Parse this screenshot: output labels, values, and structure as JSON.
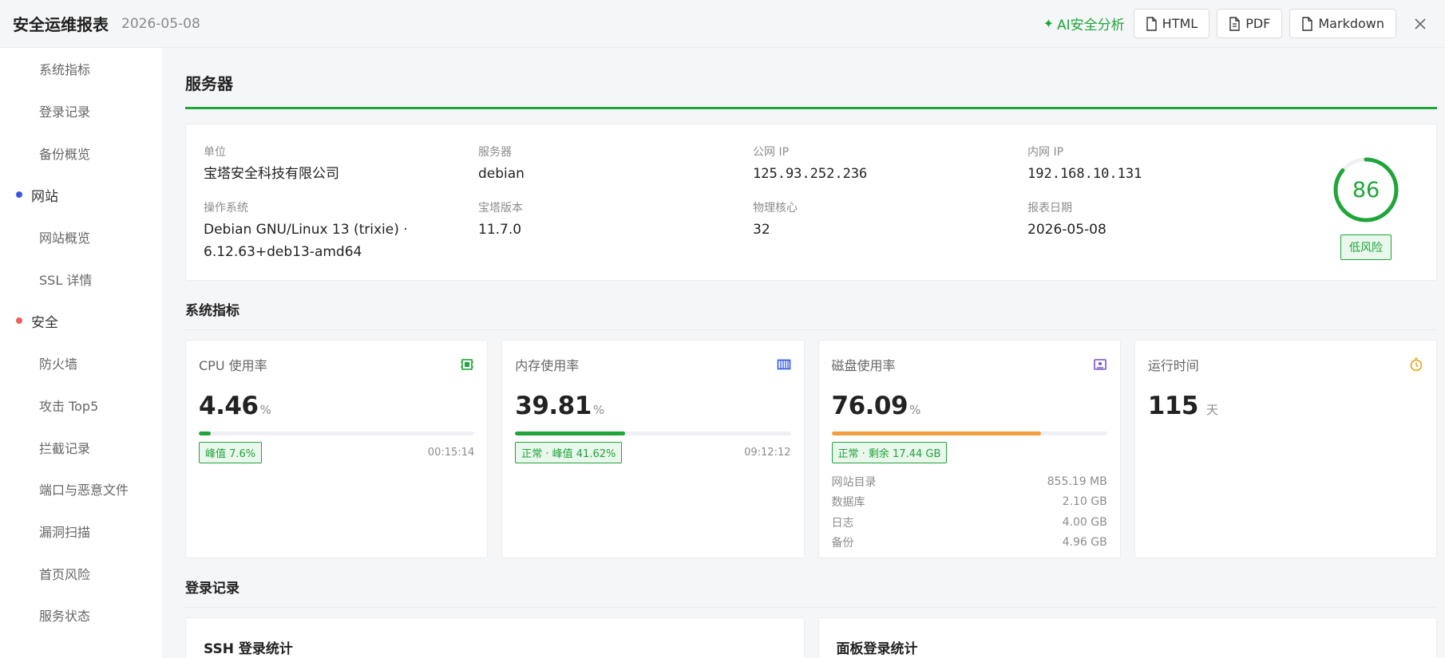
{
  "header": {
    "title": "安全运维报表",
    "date": "2026-05-08",
    "ai_label": "AI安全分析",
    "exports": [
      "HTML",
      "PDF",
      "Markdown"
    ]
  },
  "sidebar": {
    "items": [
      {
        "type": "sub",
        "label": "系统指标"
      },
      {
        "type": "sub",
        "label": "登录记录"
      },
      {
        "type": "sub",
        "label": "备份概览"
      },
      {
        "type": "group",
        "label": "网站",
        "dot_color": "#3559e0"
      },
      {
        "type": "sub",
        "label": "网站概览"
      },
      {
        "type": "sub",
        "label": "SSL 详情"
      },
      {
        "type": "group",
        "label": "安全",
        "dot_color": "#f0605a"
      },
      {
        "type": "sub",
        "label": "防火墙"
      },
      {
        "type": "sub",
        "label": "攻击 Top5"
      },
      {
        "type": "sub",
        "label": "拦截记录"
      },
      {
        "type": "sub",
        "label": "端口与恶意文件"
      },
      {
        "type": "sub",
        "label": "漏洞扫描"
      },
      {
        "type": "sub",
        "label": "首页风险"
      },
      {
        "type": "sub",
        "label": "服务状态"
      }
    ]
  },
  "server": {
    "title": "服务器",
    "fields": [
      {
        "label": "单位",
        "value": "宝塔安全科技有限公司",
        "mono": false
      },
      {
        "label": "服务器",
        "value": "debian",
        "mono": false
      },
      {
        "label": "公网 IP",
        "value": "125.93.252.236",
        "mono": true
      },
      {
        "label": "内网 IP",
        "value": "192.168.10.131",
        "mono": true
      },
      {
        "label": "操作系统",
        "value": "Debian GNU/Linux 13 (trixie) · 6.12.63+deb13-amd64",
        "mono": false
      },
      {
        "label": "宝塔版本",
        "value": "11.7.0",
        "mono": false
      },
      {
        "label": "物理核心",
        "value": "32",
        "mono": false
      },
      {
        "label": "报表日期",
        "value": "2026-05-08",
        "mono": false
      }
    ],
    "score": "86",
    "score_fraction": 0.86,
    "risk_label": "低风险"
  },
  "metrics": {
    "title": "系统指标",
    "cards": [
      {
        "label": "CPU 使用率",
        "value": "4.46",
        "unit": "%",
        "percent": 4.46,
        "bar_color": "#20a53a",
        "tag": "峰值 7.6%",
        "time": "00:15:14",
        "icon": "cpu-icon",
        "icon_color": "#20a53a"
      },
      {
        "label": "内存使用率",
        "value": "39.81",
        "unit": "%",
        "percent": 39.81,
        "bar_color": "#20a53a",
        "tag": "正常 · 峰值 41.62%",
        "time": "09:12:12",
        "icon": "memory-icon",
        "icon_color": "#3559e0"
      },
      {
        "label": "磁盘使用率",
        "value": "76.09",
        "unit": "%",
        "percent": 76.09,
        "bar_color": "#f0a040",
        "tag": "正常 · 剩余 17.44 GB",
        "time": "",
        "icon": "disk-icon",
        "icon_color": "#7a4fd6",
        "breakdown": [
          {
            "name": "网站目录",
            "size": "855.19 MB"
          },
          {
            "name": "数据库",
            "size": "2.10 GB"
          },
          {
            "name": "日志",
            "size": "4.00 GB"
          },
          {
            "name": "备份",
            "size": "4.96 GB"
          }
        ]
      },
      {
        "label": "运行时间",
        "value": "115",
        "unit": "天",
        "icon": "clock-icon",
        "icon_color": "#e8a317"
      }
    ]
  },
  "login": {
    "title": "登录记录",
    "cards": [
      "SSH 登录统计",
      "面板登录统计"
    ]
  }
}
